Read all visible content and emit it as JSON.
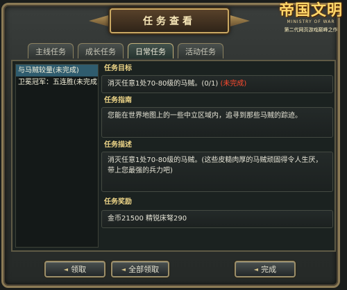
{
  "window": {
    "title": "任务查看"
  },
  "logo": {
    "main": "帝国文明",
    "sub": "MINISTRY OF WAR",
    "tagline": "第二代网页游戏巅峰之作"
  },
  "tabs": [
    {
      "label": "主线任务",
      "active": false
    },
    {
      "label": "成长任务",
      "active": false
    },
    {
      "label": "日常任务",
      "active": true
    },
    {
      "label": "活动任务",
      "active": false
    }
  ],
  "quest_list": [
    {
      "label": "与马贼较量(未完成)",
      "selected": true
    },
    {
      "label": "卫冕冠军：五连胜(未完成)",
      "selected": false
    }
  ],
  "detail": {
    "objective_title": "任务目标",
    "objective_text": "消灭任意1处70-80级的马贼。(0/1)",
    "objective_status": "(未完成)",
    "guide_title": "任务指南",
    "guide_text": "您能在世界地图上的一些中立区域内，追寻到那些马贼的踪迹。",
    "description_title": "任务描述",
    "description_text": "消灭任意1处70-80级的马贼。(这些皮糙肉厚的马贼顽固得令人生厌，带上您最强的兵力吧)",
    "reward_title": "任务奖励",
    "reward_text": "金币21500  精锐床弩290"
  },
  "buttons": {
    "claim": "领取",
    "claim_all": "全部领取",
    "complete": "完成"
  },
  "colors": {
    "accent_gold": "#ecd487",
    "status_red": "#ff4a2e",
    "selected_row": "#2f5c6e"
  }
}
